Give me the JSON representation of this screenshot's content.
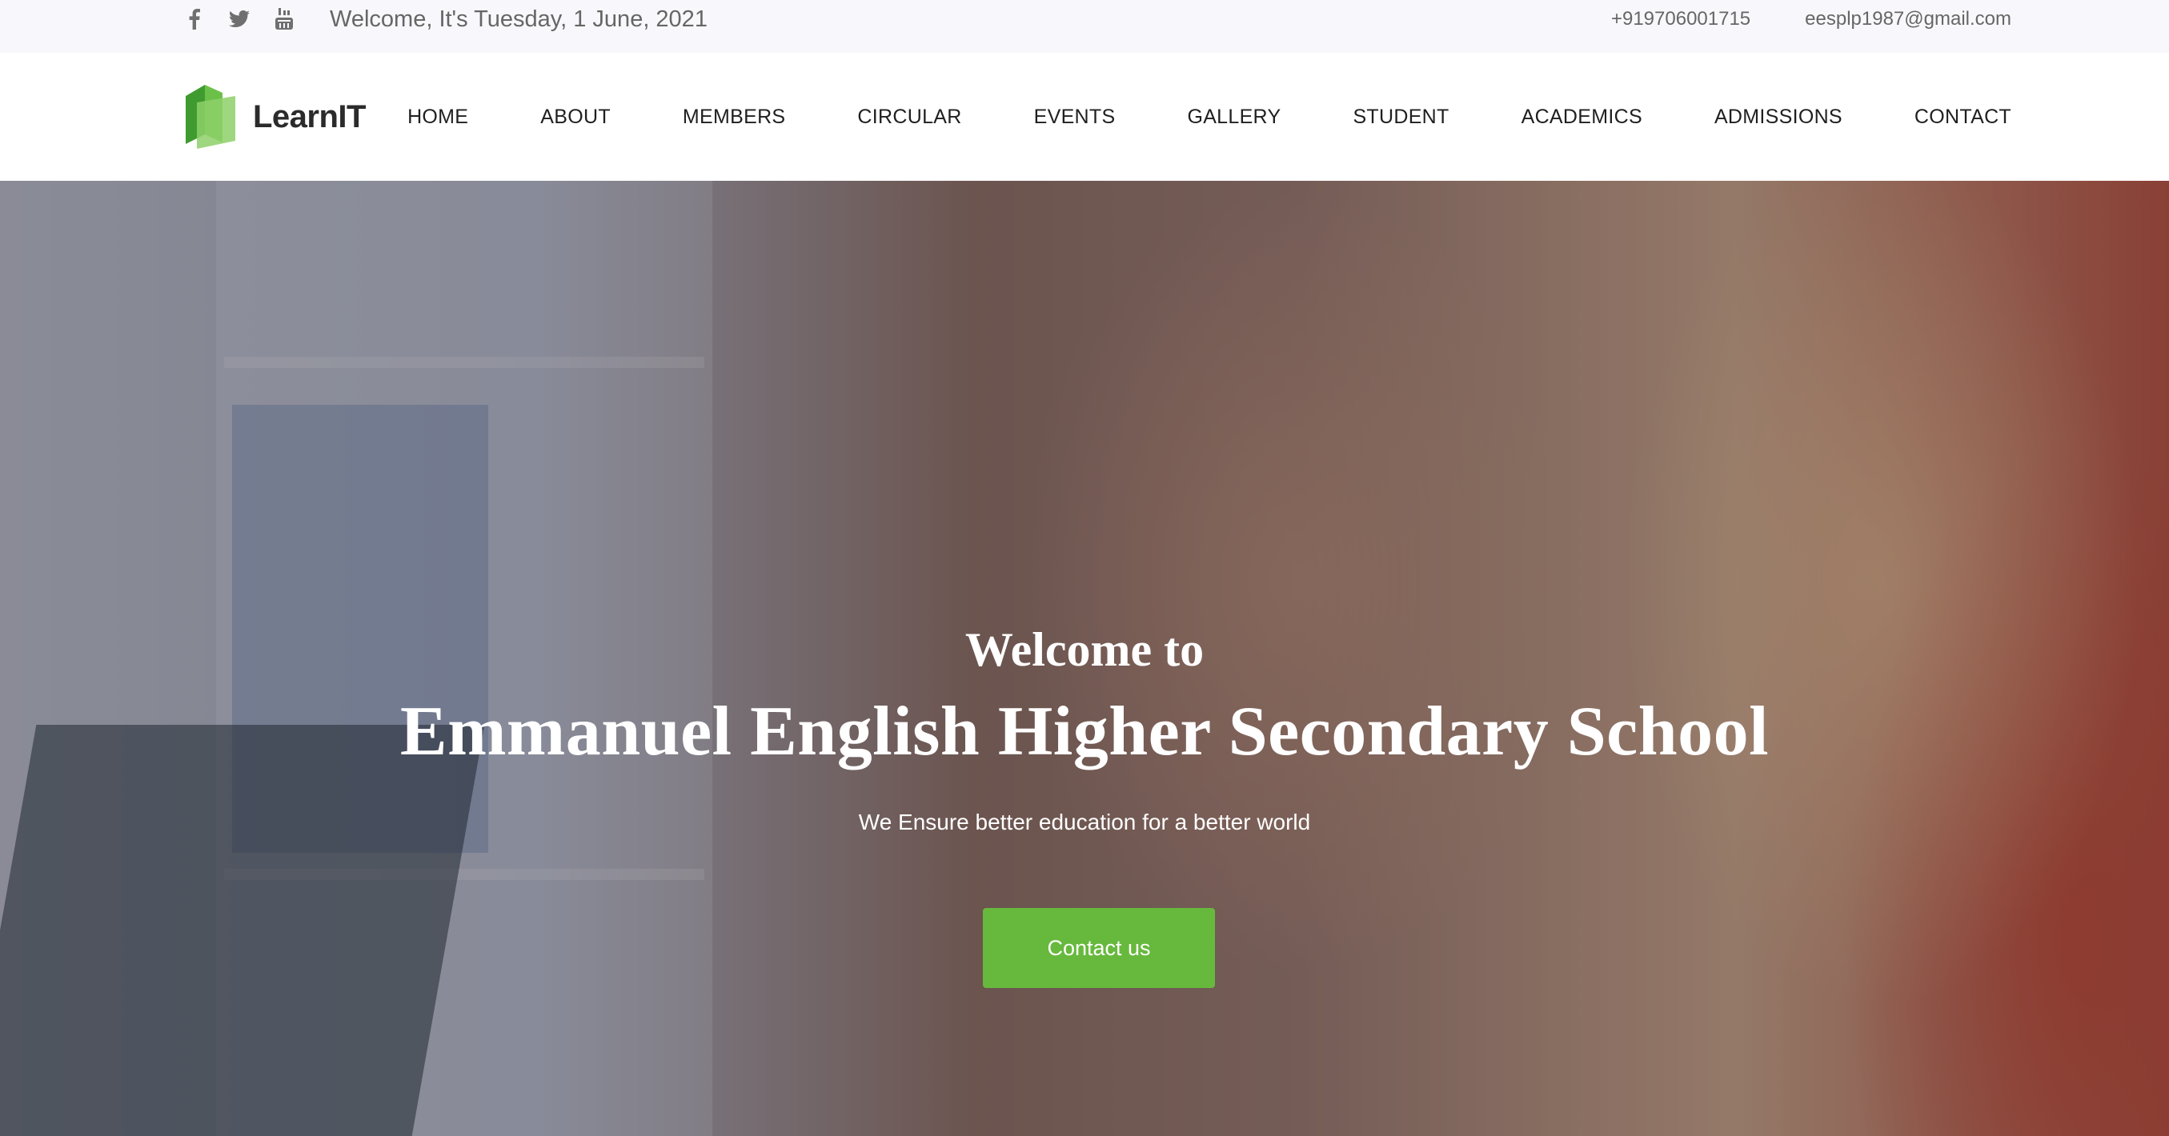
{
  "topbar": {
    "welcome": "Welcome, It's Tuesday, 1 June, 2021",
    "phone": "+919706001715",
    "email": "eesplp1987@gmail.com",
    "social_icons": [
      "facebook-icon",
      "twitter-icon",
      "youtube-icon"
    ]
  },
  "brand": {
    "name": "LearnIT",
    "logo_colors": [
      "#3f9b2f",
      "#6cc04a",
      "#8ed06a"
    ]
  },
  "nav": {
    "items": [
      {
        "label": "HOME"
      },
      {
        "label": "ABOUT"
      },
      {
        "label": "MEMBERS"
      },
      {
        "label": "CIRCULAR"
      },
      {
        "label": "EVENTS"
      },
      {
        "label": "GALLERY"
      },
      {
        "label": "STUDENT"
      },
      {
        "label": "ACADEMICS"
      },
      {
        "label": "ADMISSIONS"
      },
      {
        "label": "CONTACT"
      }
    ]
  },
  "hero": {
    "welcome": "Welcome to",
    "title": "Emmanuel English Higher Secondary School",
    "subtitle": "We Ensure better education for a better world",
    "cta_label": "Contact us",
    "cta_color": "#67b93d"
  }
}
